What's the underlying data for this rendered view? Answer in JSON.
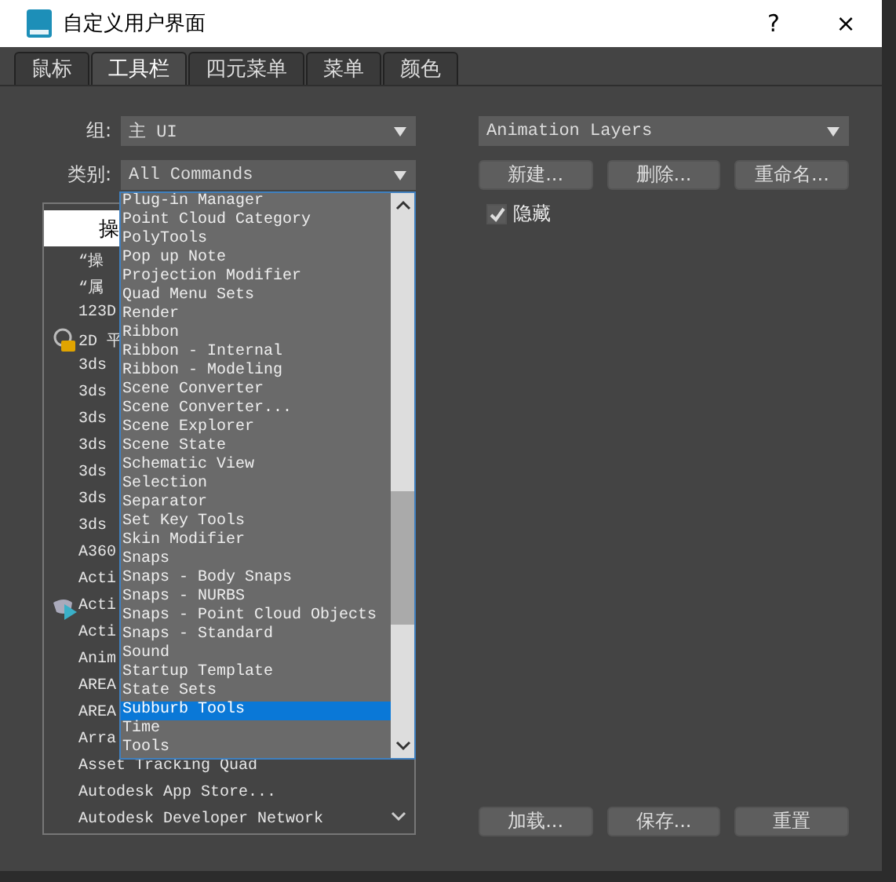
{
  "window": {
    "title": "自定义用户界面",
    "help": "?",
    "close": "×"
  },
  "tabs": [
    {
      "label": "鼠标",
      "selected": false
    },
    {
      "label": "工具栏",
      "selected": true
    },
    {
      "label": "四元菜单",
      "selected": false
    },
    {
      "label": "菜单",
      "selected": false
    },
    {
      "label": "颜色",
      "selected": false
    }
  ],
  "group": {
    "label": "组:",
    "value": "主 UI"
  },
  "category": {
    "label": "类别:",
    "value": "All Commands",
    "open": true
  },
  "action_list": {
    "header": "操",
    "items": [
      {
        "text": "“操",
        "kind": "plain"
      },
      {
        "text": "“属",
        "kind": "plain"
      },
      {
        "text": "123D",
        "kind": "plain"
      },
      {
        "text": "2D 平",
        "kind": "lock"
      },
      {
        "text": "3ds",
        "kind": "plain"
      },
      {
        "text": "3ds",
        "kind": "plain"
      },
      {
        "text": "3ds",
        "kind": "plain"
      },
      {
        "text": "3ds",
        "kind": "plain"
      },
      {
        "text": "3ds",
        "kind": "plain"
      },
      {
        "text": "3ds",
        "kind": "plain"
      },
      {
        "text": "3ds",
        "kind": "plain"
      },
      {
        "text": "A360",
        "kind": "plain"
      },
      {
        "text": "Acti",
        "kind": "plain"
      },
      {
        "text": "Acti",
        "kind": "teapot"
      },
      {
        "text": "Acti",
        "kind": "plain"
      },
      {
        "text": "Anim",
        "kind": "plain"
      },
      {
        "text": "AREA",
        "kind": "plain"
      },
      {
        "text": "AREA",
        "kind": "plain"
      },
      {
        "text": "Arra",
        "kind": "plain"
      },
      {
        "text": "Asset Tracking Quad",
        "kind": "plain"
      },
      {
        "text": "Autodesk App Store...",
        "kind": "plain"
      },
      {
        "text": "Autodesk Developer Network",
        "kind": "plain"
      }
    ]
  },
  "category_options": [
    {
      "text": "Plug-in Manager",
      "selected": false
    },
    {
      "text": "Point Cloud Category",
      "selected": false
    },
    {
      "text": "PolyTools",
      "selected": false
    },
    {
      "text": "Pop up Note",
      "selected": false
    },
    {
      "text": "Projection Modifier",
      "selected": false
    },
    {
      "text": "Quad Menu Sets",
      "selected": false
    },
    {
      "text": "Render",
      "selected": false
    },
    {
      "text": "Ribbon",
      "selected": false
    },
    {
      "text": "Ribbon - Internal",
      "selected": false
    },
    {
      "text": "Ribbon - Modeling",
      "selected": false
    },
    {
      "text": "Scene Converter",
      "selected": false
    },
    {
      "text": "Scene Converter...",
      "selected": false
    },
    {
      "text": "Scene Explorer",
      "selected": false
    },
    {
      "text": "Scene State",
      "selected": false
    },
    {
      "text": "Schematic View",
      "selected": false
    },
    {
      "text": "Selection",
      "selected": false
    },
    {
      "text": "Separator",
      "selected": false
    },
    {
      "text": "Set Key Tools",
      "selected": false
    },
    {
      "text": "Skin Modifier",
      "selected": false
    },
    {
      "text": "Snaps",
      "selected": false
    },
    {
      "text": "Snaps - Body Snaps",
      "selected": false
    },
    {
      "text": "Snaps - NURBS",
      "selected": false
    },
    {
      "text": "Snaps - Point Cloud Objects",
      "selected": false
    },
    {
      "text": "Snaps - Standard",
      "selected": false
    },
    {
      "text": "Sound",
      "selected": false
    },
    {
      "text": "Startup Template",
      "selected": false
    },
    {
      "text": "State Sets",
      "selected": false
    },
    {
      "text": "Subburb Tools",
      "selected": true
    },
    {
      "text": "Time",
      "selected": false
    },
    {
      "text": "Tools",
      "selected": false
    }
  ],
  "toolbar_select": {
    "value": "Animation Layers"
  },
  "toolbar_buttons": [
    "新建...",
    "删除...",
    "重命名..."
  ],
  "hide_checkbox": {
    "label": "隐藏",
    "checked": true
  },
  "file_buttons": [
    "加载...",
    "保存...",
    "重置"
  ]
}
